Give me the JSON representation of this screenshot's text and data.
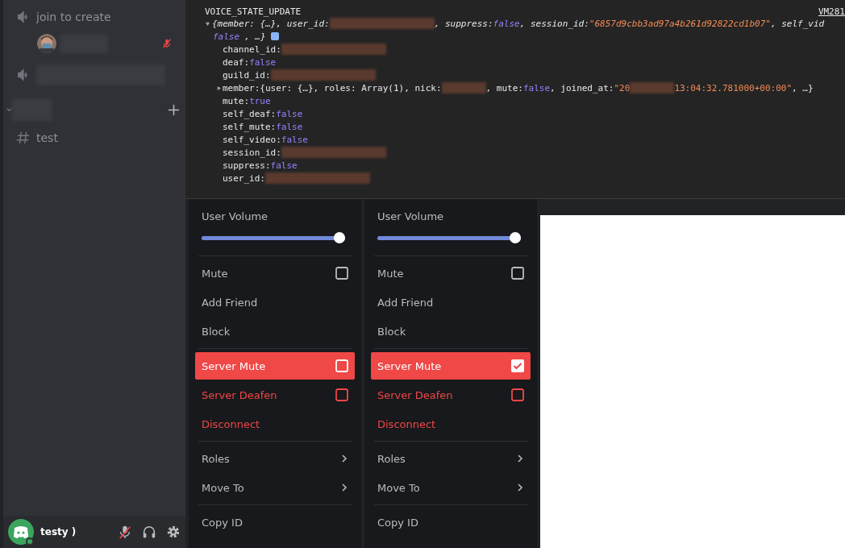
{
  "sidebar": {
    "channels": [
      {
        "kind": "voice",
        "name": "join to create",
        "members": [
          {
            "server_muted": true
          }
        ]
      },
      {
        "kind": "voice"
      },
      {
        "kind": "category",
        "expanded": true
      },
      {
        "kind": "text",
        "name": "test"
      }
    ],
    "user": {
      "name": "testy )",
      "self_muted": true
    }
  },
  "console": {
    "title": "VOICE_STATE_UPDATE",
    "source": "VM281",
    "expanded": true,
    "lines": [
      {
        "kind": "summary",
        "parts": [
          {
            "t": "{member: {…}, user_id: ",
            "kind": "plain"
          },
          {
            "kind": "redacted"
          },
          {
            "t": ", suppress: ",
            "kind": "plain"
          },
          {
            "t": "false",
            "kind": "bool"
          },
          {
            "t": ", session_id: ",
            "kind": "plain"
          },
          {
            "t": "\"6857d9cbb3ad97a4b261d92822cd1b07\"",
            "kind": "str"
          },
          {
            "t": ", self_vid",
            "kind": "plain"
          }
        ]
      },
      {
        "kind": "summary2",
        "parts": [
          {
            "t": "false",
            "kind": "bool"
          },
          {
            "t": ", …}",
            "kind": "plain"
          }
        ]
      },
      {
        "kind": "prop",
        "parts": [
          {
            "t": "channel_id: ",
            "kind": "key"
          },
          {
            "kind": "redacted"
          }
        ]
      },
      {
        "kind": "prop",
        "parts": [
          {
            "t": "deaf: ",
            "kind": "key"
          },
          {
            "t": "false",
            "kind": "bool"
          }
        ]
      },
      {
        "kind": "prop",
        "parts": [
          {
            "t": "guild_id: ",
            "kind": "key"
          },
          {
            "kind": "redacted"
          }
        ]
      },
      {
        "kind": "expandable",
        "parts": [
          {
            "t": "member: ",
            "kind": "key"
          },
          {
            "t": "{user: {…}, roles: Array(1), nick: ",
            "kind": "plain"
          },
          {
            "kind": "redacted"
          },
          {
            "t": ", mute: ",
            "kind": "plain"
          },
          {
            "t": "false",
            "kind": "bool"
          },
          {
            "t": ", joined_at: ",
            "kind": "plain"
          },
          {
            "t": "\"20",
            "kind": "str"
          },
          {
            "kind": "redacted"
          },
          {
            "t": "13:04:32.781000+00:00\"",
            "kind": "str"
          },
          {
            "t": ", …}",
            "kind": "plain"
          }
        ]
      },
      {
        "kind": "prop",
        "parts": [
          {
            "t": "mute: ",
            "kind": "key"
          },
          {
            "t": "true",
            "kind": "bool"
          }
        ]
      },
      {
        "kind": "prop",
        "parts": [
          {
            "t": "self_deaf: ",
            "kind": "key"
          },
          {
            "t": "false",
            "kind": "bool"
          }
        ]
      },
      {
        "kind": "prop",
        "parts": [
          {
            "t": "self_mute: ",
            "kind": "key"
          },
          {
            "t": "false",
            "kind": "bool"
          }
        ]
      },
      {
        "kind": "prop",
        "parts": [
          {
            "t": "self_video: ",
            "kind": "key"
          },
          {
            "t": "false",
            "kind": "bool"
          }
        ]
      },
      {
        "kind": "prop",
        "parts": [
          {
            "t": "session_id: ",
            "kind": "key"
          },
          {
            "kind": "redacted"
          }
        ]
      },
      {
        "kind": "prop",
        "parts": [
          {
            "t": "suppress: ",
            "kind": "key"
          },
          {
            "t": "false",
            "kind": "bool"
          }
        ]
      },
      {
        "kind": "prop",
        "parts": [
          {
            "t": "user_id: ",
            "kind": "key"
          },
          {
            "kind": "redacted"
          }
        ]
      }
    ]
  },
  "menus": [
    {
      "items": [
        {
          "kind": "slider",
          "label": "User Volume",
          "level": 1
        },
        {
          "kind": "sep"
        },
        {
          "kind": "checkbox",
          "label": "Mute",
          "checked": false,
          "danger": false,
          "selected": false
        },
        {
          "kind": "plain",
          "label": "Add Friend",
          "danger": false
        },
        {
          "kind": "plain",
          "label": "Block",
          "danger": false
        },
        {
          "kind": "sep"
        },
        {
          "kind": "checkbox",
          "label": "Server Mute",
          "checked": false,
          "danger": true,
          "selected": true
        },
        {
          "kind": "checkbox",
          "label": "Server Deafen",
          "checked": false,
          "danger": true,
          "selected": false
        },
        {
          "kind": "plain",
          "label": "Disconnect",
          "danger": true
        },
        {
          "kind": "sep"
        },
        {
          "kind": "submenu",
          "label": "Roles"
        },
        {
          "kind": "submenu",
          "label": "Move To"
        },
        {
          "kind": "sep"
        },
        {
          "kind": "plain",
          "label": "Copy ID",
          "danger": false
        }
      ]
    },
    {
      "items": [
        {
          "kind": "slider",
          "label": "User Volume",
          "level": 1
        },
        {
          "kind": "sep"
        },
        {
          "kind": "checkbox",
          "label": "Mute",
          "checked": false,
          "danger": false,
          "selected": false
        },
        {
          "kind": "plain",
          "label": "Add Friend",
          "danger": false
        },
        {
          "kind": "plain",
          "label": "Block",
          "danger": false
        },
        {
          "kind": "sep"
        },
        {
          "kind": "checkbox",
          "label": "Server Mute",
          "checked": true,
          "danger": true,
          "selected": true
        },
        {
          "kind": "checkbox",
          "label": "Server Deafen",
          "checked": false,
          "danger": true,
          "selected": false
        },
        {
          "kind": "plain",
          "label": "Disconnect",
          "danger": true
        },
        {
          "kind": "sep"
        },
        {
          "kind": "submenu",
          "label": "Roles"
        },
        {
          "kind": "submenu",
          "label": "Move To"
        },
        {
          "kind": "sep"
        },
        {
          "kind": "plain",
          "label": "Copy ID",
          "danger": false
        }
      ]
    }
  ]
}
